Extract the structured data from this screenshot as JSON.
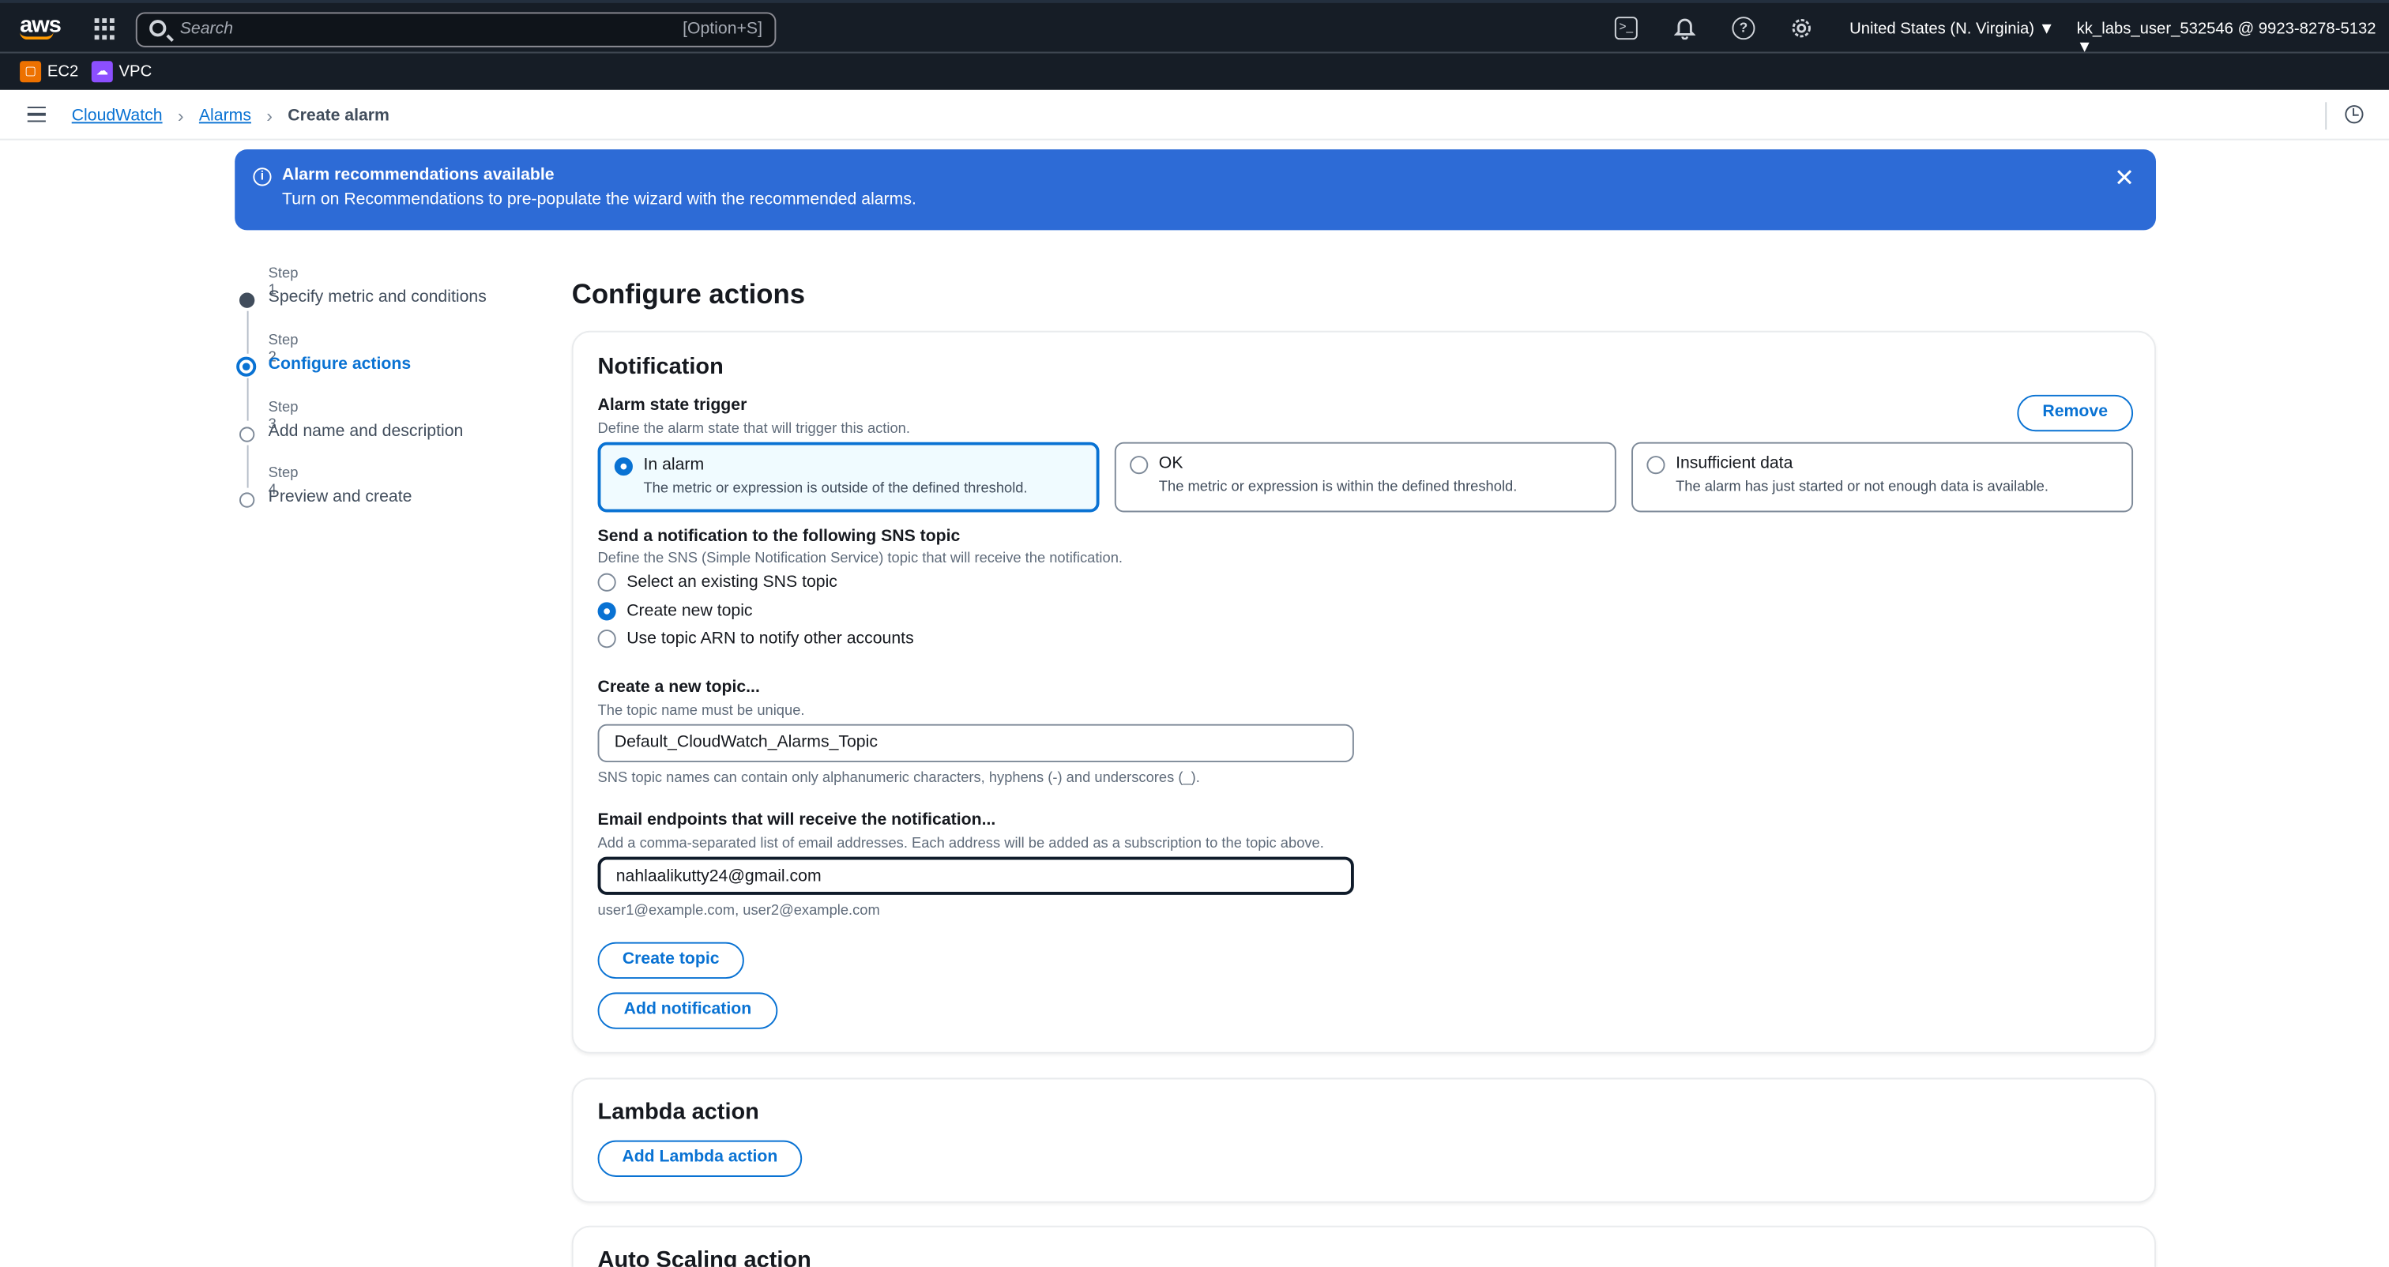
{
  "topnav": {
    "logo": "aws",
    "search_placeholder": "Search",
    "search_shortcut": "[Option+S]",
    "region": "United States (N. Virginia) ▼",
    "account": "kk_labs_user_532546 @ 9923-8278-5132 ▼",
    "icons": [
      "cloudshell-icon",
      "bell-icon",
      "help-icon",
      "gear-icon"
    ]
  },
  "favorites": [
    {
      "label": "EC2",
      "color": "#ed7100"
    },
    {
      "label": "VPC",
      "color": "#8c4fff"
    }
  ],
  "breadcrumb": {
    "items": [
      "CloudWatch",
      "Alarms"
    ],
    "current": "Create alarm"
  },
  "flash": {
    "title": "Alarm recommendations available",
    "message": "Turn on Recommendations to pre-populate the wizard with the recommended alarms.",
    "color": "#2d6bd6"
  },
  "steps": [
    {
      "num": "Step 1",
      "label": "Specify metric and conditions",
      "state": "done"
    },
    {
      "num": "Step 2",
      "label": "Configure actions",
      "state": "active"
    },
    {
      "num": "Step 3",
      "label": "Add name and description",
      "state": "pending"
    },
    {
      "num": "Step 4",
      "label": "Preview and create",
      "state": "pending"
    }
  ],
  "page_title": "Configure actions",
  "notification": {
    "heading": "Notification",
    "remove_label": "Remove",
    "trigger_label": "Alarm state trigger",
    "trigger_desc": "Define the alarm state that will trigger this action.",
    "tiles": [
      {
        "title": "In alarm",
        "desc": "The metric or expression is outside of the defined threshold.",
        "selected": true
      },
      {
        "title": "OK",
        "desc": "The metric or expression is within the defined threshold.",
        "selected": false
      },
      {
        "title": "Insufficient data",
        "desc": "The alarm has just started or not enough data is available.",
        "selected": false
      }
    ],
    "sns_label": "Send a notification to the following SNS topic",
    "sns_desc": "Define the SNS (Simple Notification Service) topic that will receive the notification.",
    "sns_options": [
      {
        "label": "Select an existing SNS topic",
        "selected": false
      },
      {
        "label": "Create new topic",
        "selected": true
      },
      {
        "label": "Use topic ARN to notify other accounts",
        "selected": false
      }
    ],
    "topic_label": "Create a new topic...",
    "topic_desc": "The topic name must be unique.",
    "topic_value": "Default_CloudWatch_Alarms_Topic",
    "topic_hint": "SNS topic names can contain only alphanumeric characters, hyphens (-) and underscores (_).",
    "email_label": "Email endpoints that will receive the notification...",
    "email_desc": "Add a comma-separated list of email addresses. Each address will be added as a subscription to the topic above.",
    "email_value": "nahlaalikutty24@gmail.com",
    "email_hint": "user1@example.com, user2@example.com",
    "create_topic_label": "Create topic",
    "add_notification_label": "Add notification"
  },
  "lambda": {
    "heading": "Lambda action",
    "button": "Add Lambda action"
  },
  "autoscaling": {
    "heading": "Auto Scaling action"
  }
}
